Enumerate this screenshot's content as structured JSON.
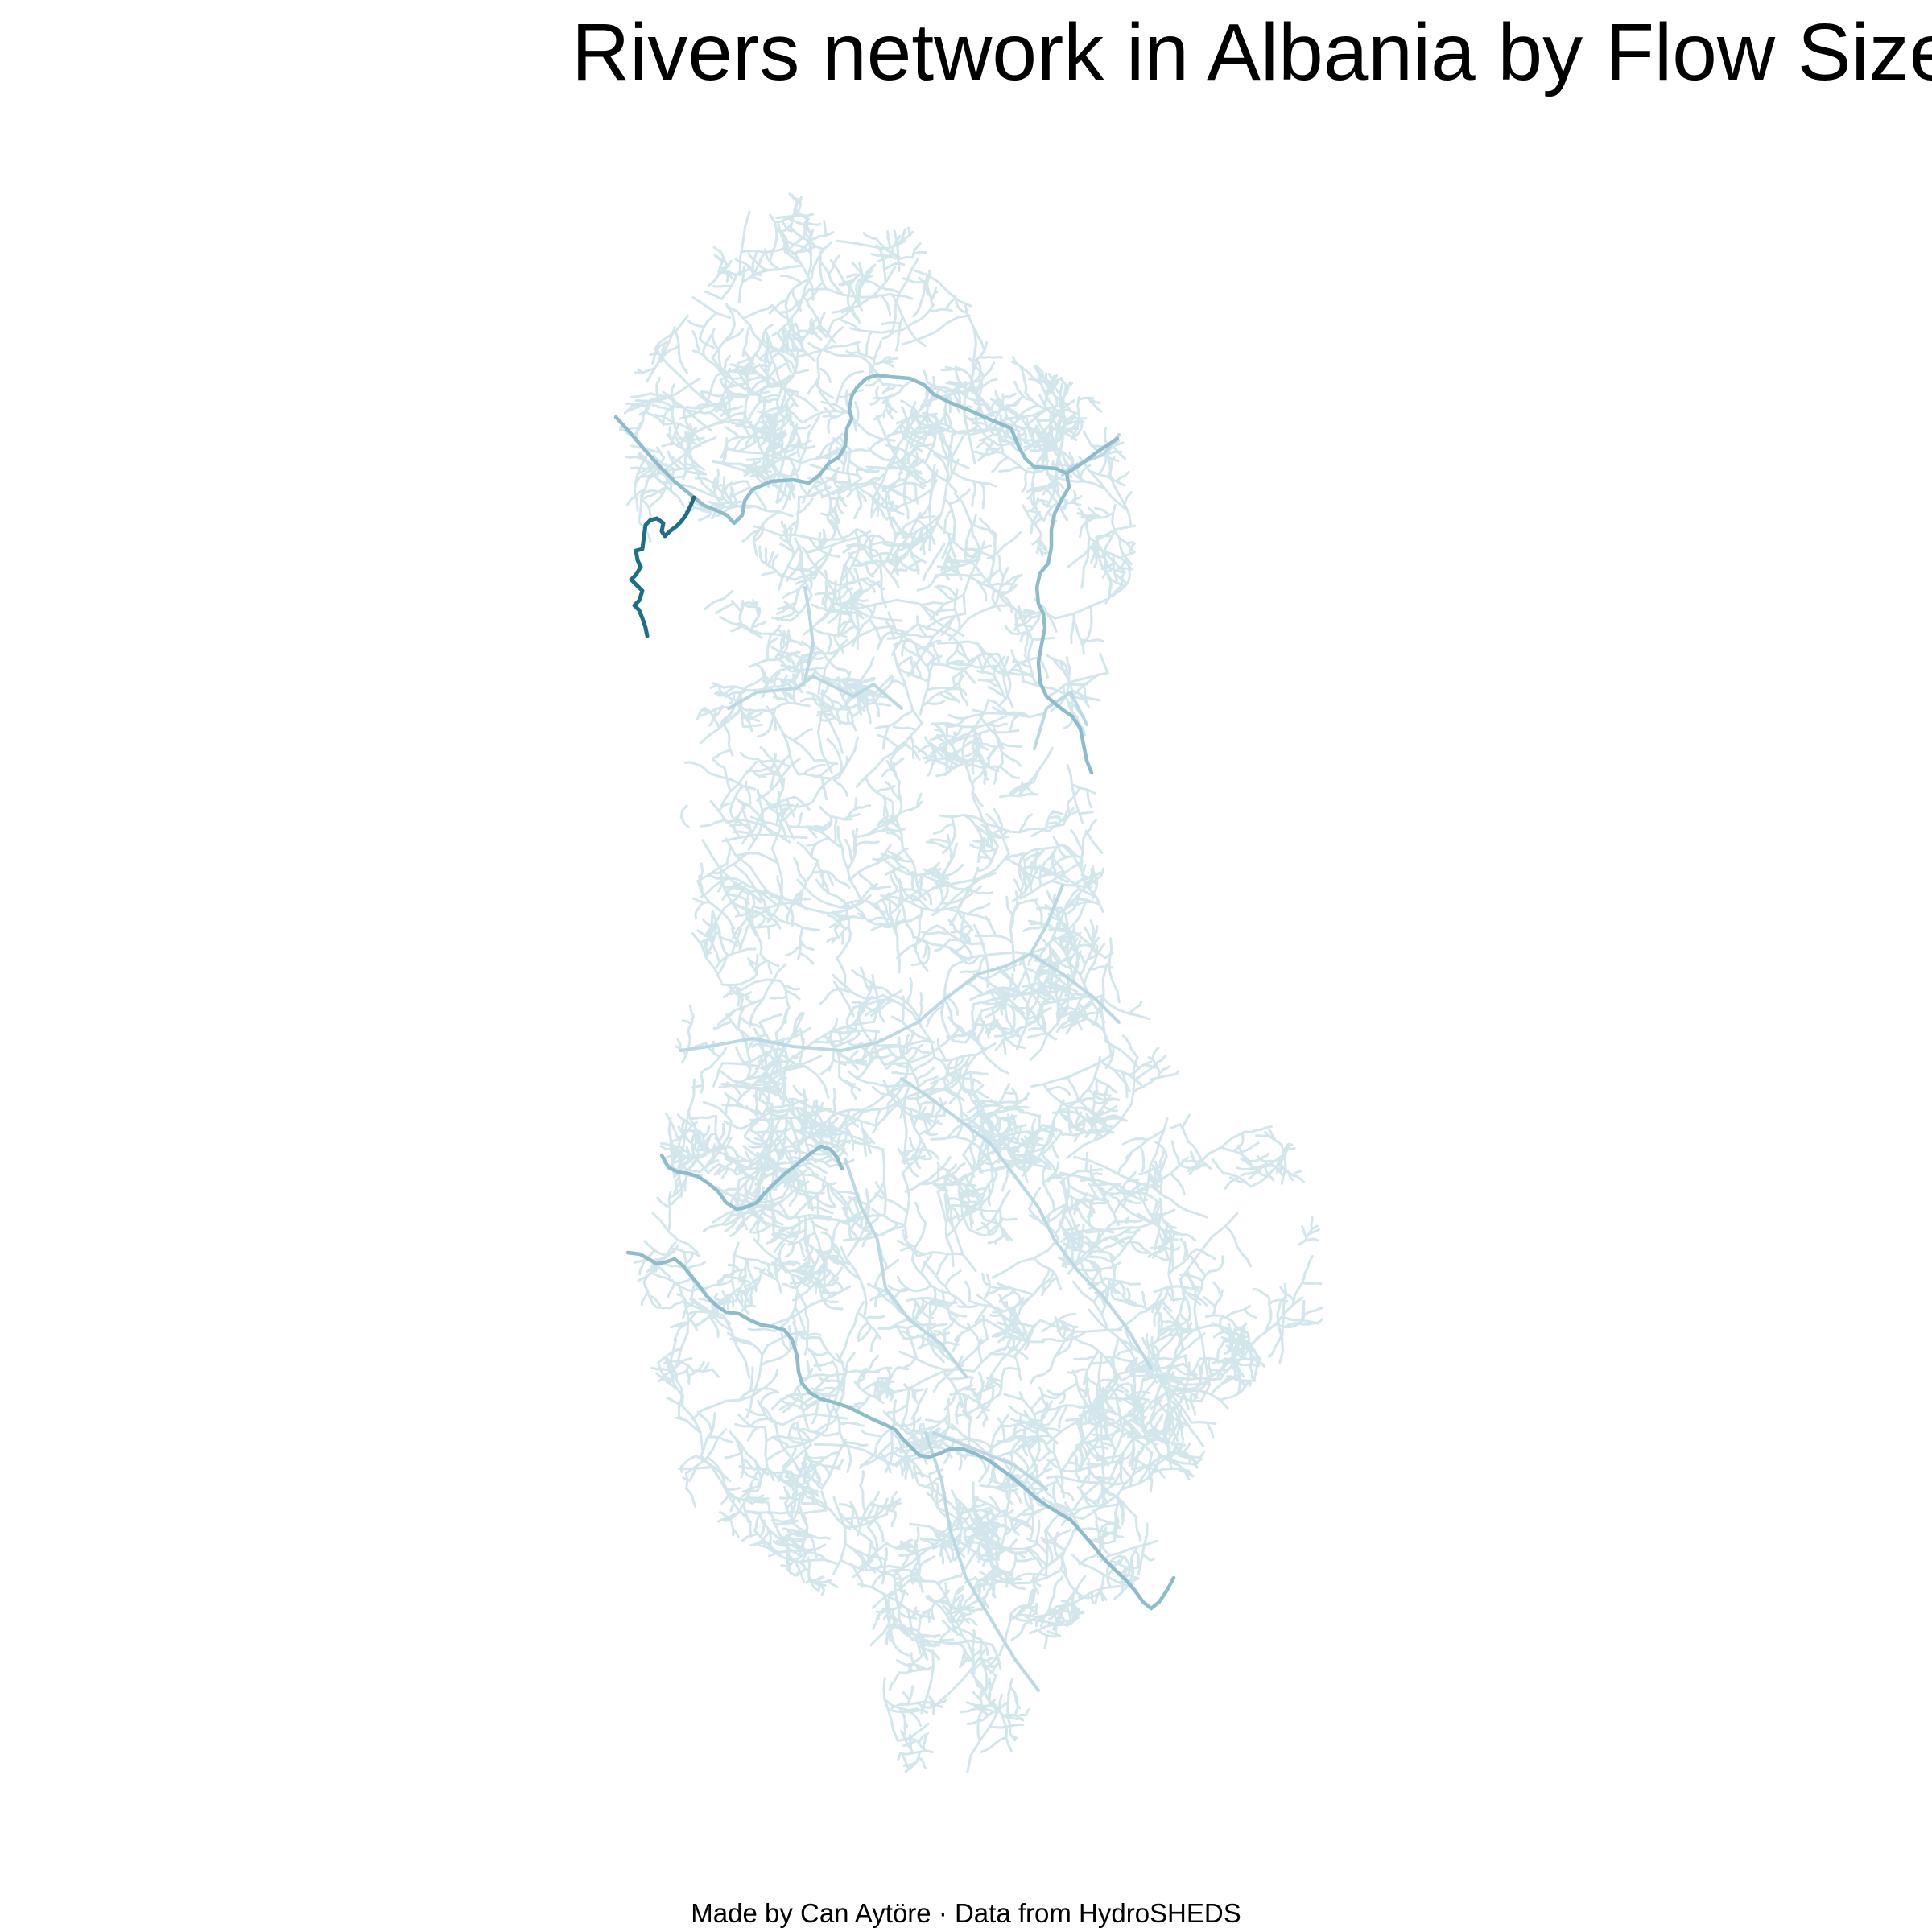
{
  "title": "Rivers network in Albania by Flow Size",
  "caption": "Made by Can Aytöre · Data from HydroSHEDS",
  "colors": {
    "background": "#ffffff",
    "river_tiny": "#d3e6ec",
    "river_small": "#bcd9e3",
    "river_medium": "#8fbccb",
    "river_large": "#1e6f86"
  }
}
